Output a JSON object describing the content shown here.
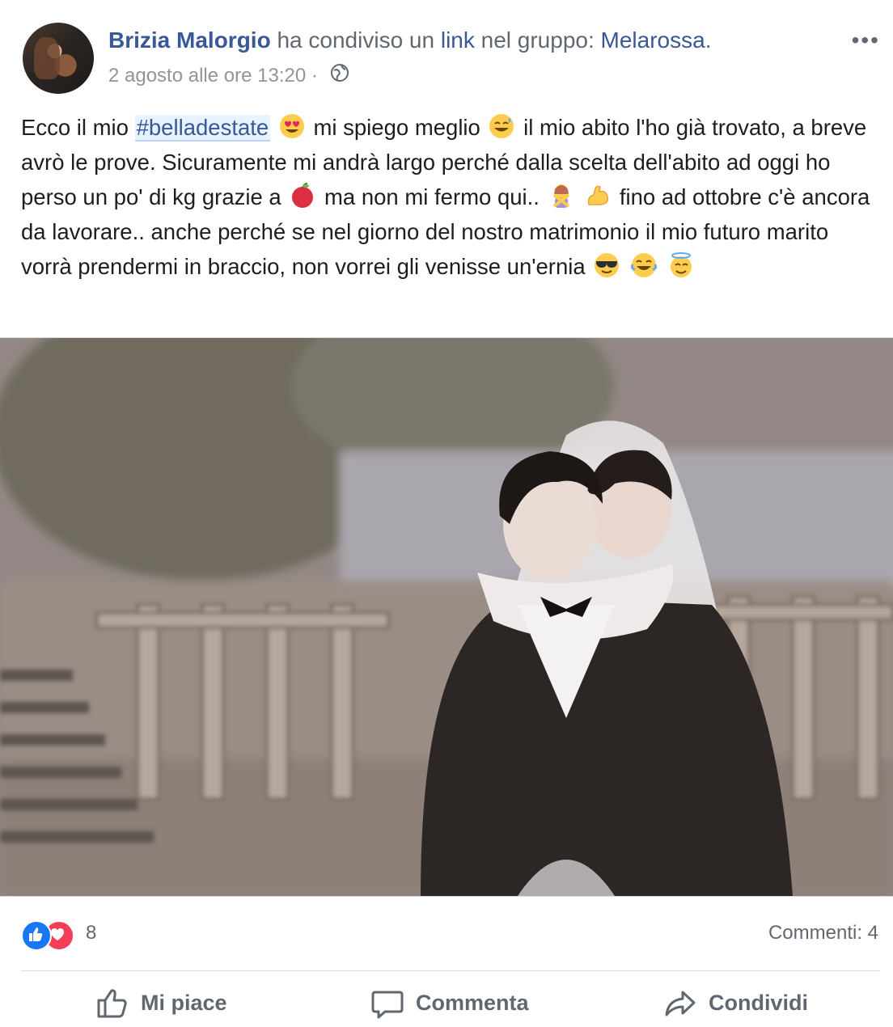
{
  "post": {
    "author": "Brizia Malorgio",
    "shared_text": "ha condiviso un",
    "link_text": "link",
    "group_prefix": "nel gruppo:",
    "group_name": "Melarossa",
    "period": ".",
    "timestamp": "2 agosto alle ore 13:20",
    "separator": "·",
    "privacy_icon": "globe-icon",
    "more_label": "•••",
    "text": {
      "p1": "Ecco il mio ",
      "hashtag": "#belladestate",
      "p2": " mi spiego meglio ",
      "p3": " il mio abito l'ho già trovato, a breve avrò le prove. Sicuramente mi andrà largo perché dalla scelta dell'abito ad oggi ho perso un po' di kg grazie a ",
      "p4": " ma non mi fermo qui..",
      "p5": " fino ad ottobre c'è ancora da lavorare.. anche perché se nel giorno del nostro matrimonio il mio futuro marito vorrà prendermi in braccio, non vorrei gli venisse un'ernia "
    },
    "emojis": [
      "heart-eyes-emoji",
      "sweat-smile-emoji",
      "apple-emoji",
      "no-gesture-emoji",
      "flexed-biceps-emoji",
      "sunglasses-emoji",
      "tears-of-joy-emoji",
      "halo-emoji"
    ]
  },
  "stats": {
    "reaction_icons": [
      "like-reaction-icon",
      "love-reaction-icon"
    ],
    "reactions_count": "8",
    "comments": "Commenti: 4"
  },
  "actions": {
    "like": "Mi piace",
    "comment": "Commenta",
    "share": "Condividi"
  },
  "colors": {
    "link": "#385898",
    "muted": "#606770",
    "like_blue": "#1877f2",
    "love_red": "#f33e58"
  }
}
